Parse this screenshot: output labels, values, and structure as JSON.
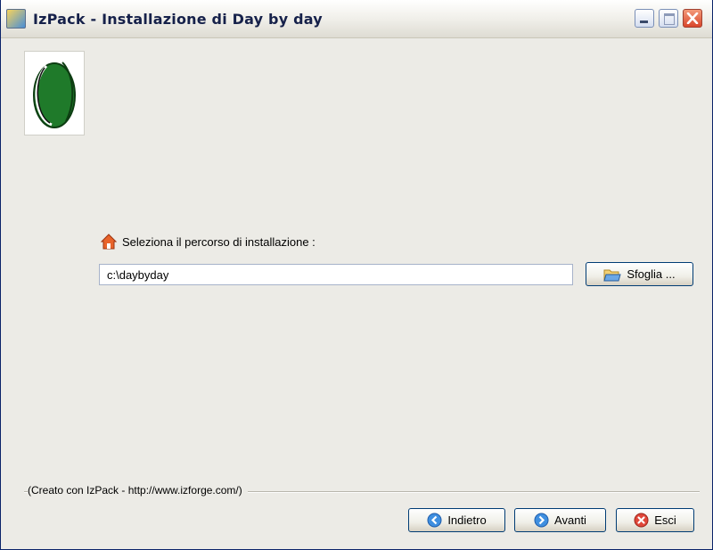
{
  "window": {
    "title": "IzPack - Installazione di Day by day",
    "controls": {
      "minimize": "minimize-icon",
      "maximize": "maximize-icon",
      "close": "close-icon"
    }
  },
  "panel": {
    "path_label": "Seleziona il percorso di installazione :",
    "path_value": "c:\\daybyday",
    "browse_label": "Sfoglia ..."
  },
  "footer": {
    "credit": "(Creato con IzPack - http://www.izforge.com/)",
    "back_label": "Indietro",
    "next_label": "Avanti",
    "quit_label": "Esci"
  },
  "icons": [
    "installer-icon",
    "home-icon",
    "folder-open-icon",
    "back-arrow-icon",
    "forward-arrow-icon",
    "quit-x-icon"
  ],
  "colors": {
    "titlebar_text": "#16214a",
    "window_bg": "#ecebe6",
    "button_border": "#003c74",
    "close_red": "#d9462b"
  }
}
